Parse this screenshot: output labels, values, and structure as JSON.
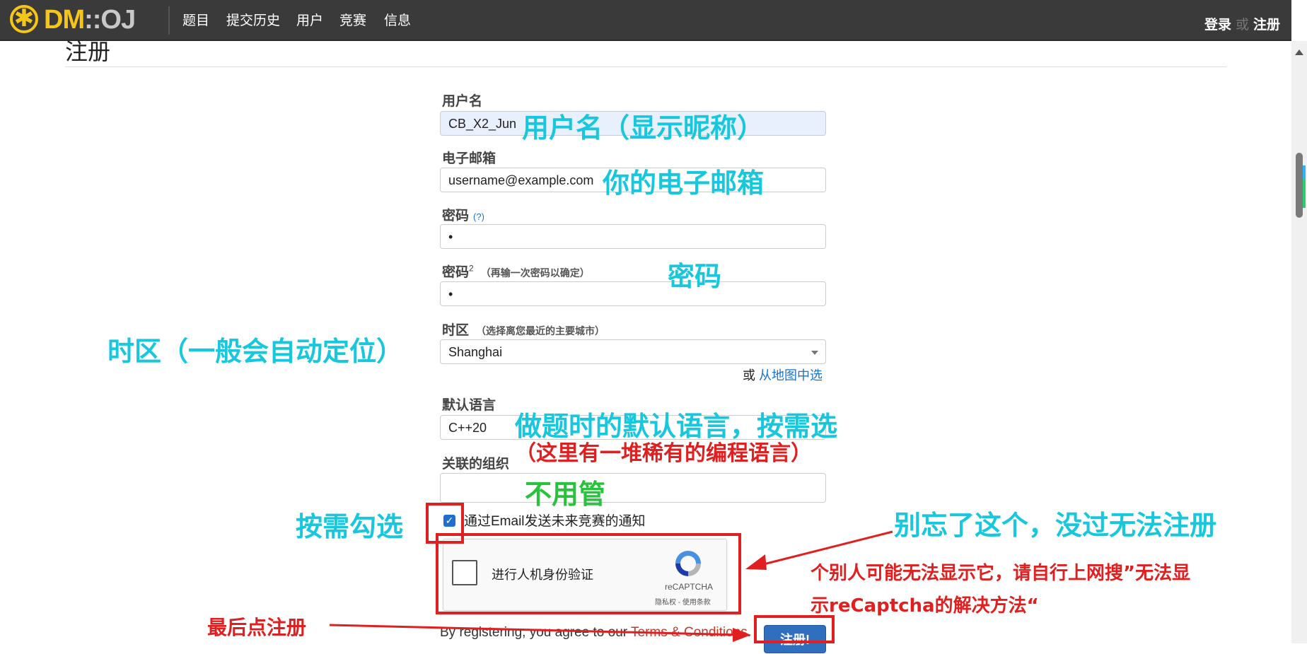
{
  "navbar": {
    "logo_main": "DM",
    "logo_sep": "::",
    "logo_oj": "OJ",
    "items": [
      "题目",
      "提交历史",
      "用户",
      "竞赛",
      "信息"
    ],
    "login": "登录",
    "or": "或",
    "register": "注册"
  },
  "page": {
    "title": "注册"
  },
  "form": {
    "username_label": "用户名",
    "username_value": "CB_X2_Jun",
    "email_label": "电子邮箱",
    "email_value": "username@example.com",
    "password_label": "密码",
    "password_help": "(?)",
    "password_value": "•",
    "password2_label": "密码",
    "password2_sup": "2",
    "password2_hint": "（再输一次密码以确定）",
    "password2_value": "•",
    "timezone_label": "时区",
    "timezone_hint": "（选择离您最近的主要城市）",
    "timezone_value": "Shanghai",
    "map_or": "或",
    "map_link": "从地图中选",
    "language_label": "默认语言",
    "language_value": "C++20",
    "org_label": "关联的组织",
    "org_value": "",
    "notify_label": "通过Email发送未来竞赛的通知",
    "notify_checked": true,
    "agree_prefix": "By registering, you agree to our",
    "agree_link": "Terms & Conditions",
    "submit_label": "注册!"
  },
  "recaptcha": {
    "label": "进行人机身份验证",
    "brand": "reCAPTCHA",
    "terms": "隐私权 - 使用条款"
  },
  "annotations": {
    "username": "用户名（显示昵称）",
    "email": "你的电子邮箱",
    "password": "密码",
    "timezone": "时区（一般会自动定位）",
    "language_1": "做题时的默认语言，按需选",
    "language_2": "（这里有一堆稀有的编程语言）",
    "org": "不用管",
    "notify": "按需勾选",
    "captcha_1": "别忘了这个，没过无法注册",
    "captcha_2": "个别人可能无法显示它，请自行上网搜”无法显",
    "captcha_3": "示reCaptcha的解决方法“",
    "submit": "最后点注册"
  },
  "colors": {
    "navbar": "#3a3a3a",
    "logo": "#f5c518",
    "annotation_cyan": "#17c7dd",
    "annotation_green": "#28c23c",
    "annotation_red": "#e02020",
    "link": "#1a73c8",
    "button": "#2f6fbd"
  }
}
